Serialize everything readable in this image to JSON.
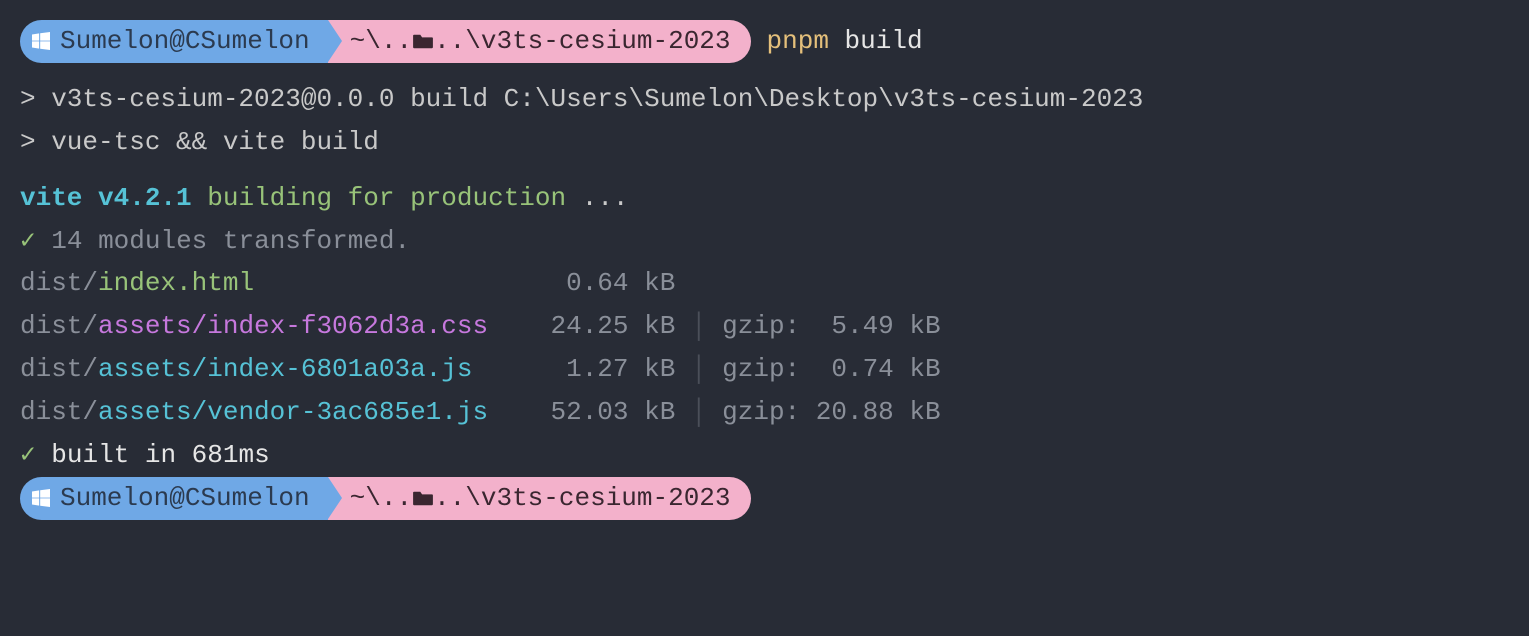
{
  "prompt1": {
    "user": "Sumelon@CSumelon",
    "path_pre": "~\\..",
    "path_post": "..\\v3ts-cesium-2023",
    "cmd1": "pnpm",
    "cmd2": "build"
  },
  "out": {
    "line1": "> v3ts-cesium-2023@0.0.0 build C:\\Users\\Sumelon\\Desktop\\v3ts-cesium-2023",
    "line2": "> vue-tsc && vite build",
    "vite_pre": "vite v4.2.1",
    "vite_post": " building for production",
    "vite_dots": " ...",
    "check": "✓",
    "transformed": " 14 modules transformed.",
    "rows": [
      {
        "dist": "dist/",
        "file": "index.html                  ",
        "cls": "c-green",
        "size": "  0.64 kB",
        "sep": "",
        "gzip": ""
      },
      {
        "dist": "dist/",
        "file": "assets/index-f3062d3a.css   ",
        "cls": "c-magenta",
        "size": " 24.25 kB",
        "sep": " │ ",
        "gzip": "gzip:  5.49 kB"
      },
      {
        "dist": "dist/",
        "file": "assets/index-6801a03a.js    ",
        "cls": "c-cyan",
        "size": "  1.27 kB",
        "sep": " │ ",
        "gzip": "gzip:  0.74 kB"
      },
      {
        "dist": "dist/",
        "file": "assets/vendor-3ac685e1.js   ",
        "cls": "c-cyan",
        "size": " 52.03 kB",
        "sep": " │ ",
        "gzip": "gzip: 20.88 kB"
      }
    ],
    "built_check": "✓",
    "built": " built in 681ms"
  },
  "prompt2": {
    "user": "Sumelon@CSumelon",
    "path_pre": "~\\..",
    "path_post": "..\\v3ts-cesium-2023"
  }
}
